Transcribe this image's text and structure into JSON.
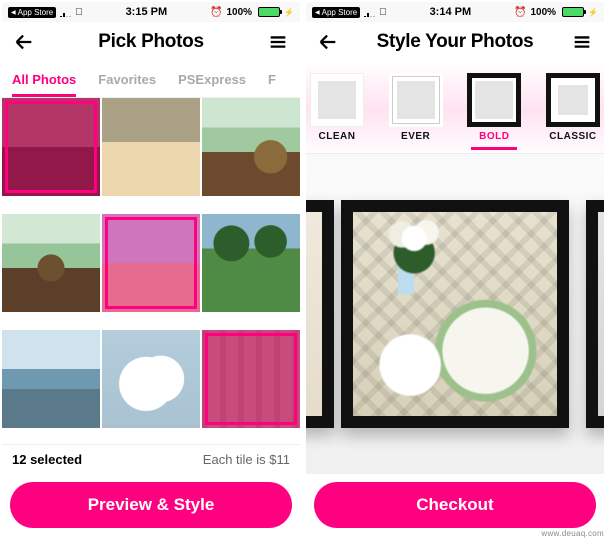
{
  "statusbar": {
    "breadcrumb_label": "App Store",
    "battery_pct": "100%"
  },
  "screens": [
    {
      "time": "3:15 PM",
      "nav_title": "Pick Photos",
      "tabs": [
        {
          "label": "All Photos",
          "active": true
        },
        {
          "label": "Favorites",
          "active": false
        },
        {
          "label": "PSExpress",
          "active": false
        },
        {
          "label": "F",
          "active": false
        }
      ],
      "grid_photos": [
        {
          "name": "restaurant-interior",
          "selected": true
        },
        {
          "name": "street-walk",
          "selected": false
        },
        {
          "name": "garden-chairs-1",
          "selected": false
        },
        {
          "name": "garden-chairs-2",
          "selected": false
        },
        {
          "name": "beach",
          "selected": true
        },
        {
          "name": "park",
          "selected": false
        },
        {
          "name": "lakeside",
          "selected": false
        },
        {
          "name": "cloud",
          "selected": false
        },
        {
          "name": "standing-stones",
          "selected": true
        }
      ],
      "footer": {
        "selected_text": "12 selected",
        "price_text": "Each tile is $11"
      },
      "cta_label": "Preview & Style"
    },
    {
      "time": "3:14 PM",
      "nav_title": "Style Your Photos",
      "styles": [
        {
          "label": "CLEAN",
          "active": false
        },
        {
          "label": "EVER",
          "active": false
        },
        {
          "label": "BOLD",
          "active": true
        },
        {
          "label": "CLASSIC",
          "active": false
        }
      ],
      "cta_label": "Checkout"
    }
  ],
  "watermark": "www.deuaq.com",
  "colors": {
    "accent": "#ff0080",
    "battery_fill": "#4cd964"
  }
}
